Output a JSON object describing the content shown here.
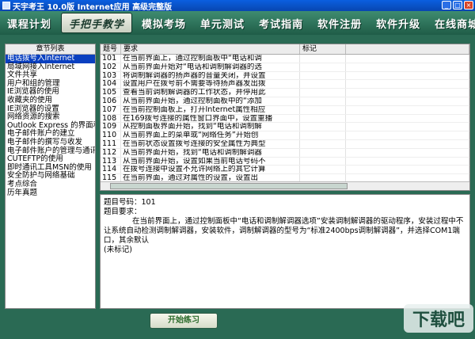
{
  "window": {
    "title": "天宇考王 10.0版 Internet应用 高级完整版",
    "buttons": {
      "minimize": "_",
      "maximize": "□",
      "close": "×"
    }
  },
  "toolbar": {
    "items": [
      "课程计划",
      "手把手教学",
      "模拟考场",
      "单元测试",
      "考试指南",
      "软件注册",
      "软件升级",
      "在线商城"
    ],
    "active_index": 1
  },
  "chapter_list": {
    "header": "章节列表",
    "items": [
      "电话拨号入Internet",
      "局域网接入Internet",
      "文件共享",
      "用户和组的管理",
      "IE浏览器的使用",
      "收藏夹的使用",
      "IE浏览器的设置",
      "网络资源的搜索",
      "Outlook Express 的界面和",
      "电子邮件账户的建立",
      "电子邮件的撰写与收发",
      "电子邮件账户的管理与通讯",
      "CUTEFTP的使用",
      "即时通讯工具MSN的使用",
      "安全防护与网络基础",
      "考点综合",
      "历年真题"
    ],
    "selected_index": 0
  },
  "questions_table": {
    "headers": {
      "num": "题号",
      "req": "要求",
      "mark": "标记"
    },
    "rows": [
      {
        "num": "101",
        "req": "在当前界面上，通过控制面板中“电话和调"
      },
      {
        "num": "102",
        "req": "从当前界面开始对“电话和调制解调器的选"
      },
      {
        "num": "103",
        "req": "将调制解调器的扬声器的音量关闭，并设置"
      },
      {
        "num": "104",
        "req": "设置用户在拨号前不需要等待扬声器发出拨"
      },
      {
        "num": "105",
        "req": "查看当前调制解调器的工作状态，并停用此"
      },
      {
        "num": "106",
        "req": "从当前界面开始，通过控制面板中的“添加"
      },
      {
        "num": "107",
        "req": "在当前控制面板上，打开Internet属性相应"
      },
      {
        "num": "108",
        "req": "在169拨号连接的属性窗口界面中，设置重播"
      },
      {
        "num": "109",
        "req": "从控制面板界面开始，找到“电话和调制解"
      },
      {
        "num": "110",
        "req": "从当前界面上的菜单或“网络任务”开始创"
      },
      {
        "num": "111",
        "req": "在当前状态设置拨号连接的安全属性为典型"
      },
      {
        "num": "112",
        "req": "从当前界面开始，找到“电话和调制解调器"
      },
      {
        "num": "113",
        "req": "从当前界面开始，设置如果当前电话号码不"
      },
      {
        "num": "114",
        "req": "在拨号连接中设置不允许网络上的其它计算"
      },
      {
        "num": "115",
        "req": "在当前界面，通过对属性的设置，设置出"
      }
    ]
  },
  "detail": {
    "number_line": "题目号码：101",
    "requirement_label": "题目要求：",
    "text": "在当前界面上，通过控制面板中“电话和调制解调器选项”安装调制解调器的驱动程序，安装过程中不让系统自动检测调制解调器，安装软件，调制解调器的型号为“标准2400bps调制解调器”，并选择COM1端口，其余默认",
    "mark_status": "(未标记)"
  },
  "start_button": {
    "label": "开始练习"
  },
  "watermark": {
    "text": "下载吧"
  },
  "colors": {
    "background": "#2a6a54",
    "toolbar": "#2f7a5e",
    "selection": "#0a40c0",
    "titlebar": "#0a5fe0"
  }
}
